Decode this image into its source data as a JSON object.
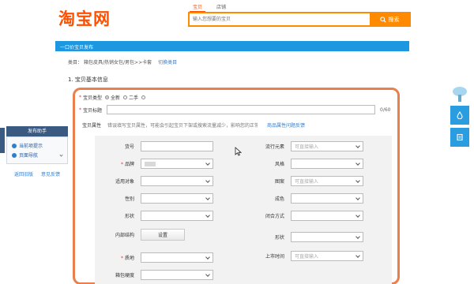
{
  "logo": "淘宝网",
  "search": {
    "tabs": [
      "宝贝",
      "店铺"
    ],
    "placeholder": "输入您想要的宝贝",
    "button": "搜索"
  },
  "banner": "一口价宝贝发布",
  "breadcrumb": {
    "prefix": "类目：",
    "path": "箱包皮具/热销女包/男包>>卡套",
    "switch": "切换类目"
  },
  "section_title": "1. 宝贝基本信息",
  "form": {
    "type_label": "宝贝类型",
    "type_options": [
      "全新",
      "二手"
    ],
    "title_label": "宝贝标题",
    "counter": "0/60",
    "attr_label": "宝贝属性",
    "attr_note": "错误填写宝贝属性，可能会引起宝贝下架或搜索流量减少，影响您的正常销售，请认真准确填写！",
    "attr_link": "商品属性问题反馈"
  },
  "attributes": {
    "left": [
      {
        "label": "货号",
        "kind": "text",
        "required": false
      },
      {
        "label": "品牌",
        "kind": "select",
        "required": true,
        "blot": true
      },
      {
        "label": "适用对象",
        "kind": "select",
        "required": false
      },
      {
        "label": "性别",
        "kind": "select",
        "required": false
      },
      {
        "label": "形状",
        "kind": "select",
        "required": false
      },
      {
        "label": "内部结构",
        "kind": "button",
        "button": "设置",
        "required": false
      },
      {
        "label": "质地",
        "kind": "select",
        "required": true
      },
      {
        "label": "箱包硬度",
        "kind": "select",
        "required": false
      }
    ],
    "right": [
      {
        "label": "流行元素",
        "placeholder": "可直接输入"
      },
      {
        "label": "风格",
        "placeholder": ""
      },
      {
        "label": "图案",
        "placeholder": "可直接输入"
      },
      {
        "label": "成色",
        "placeholder": ""
      },
      {
        "label": "闭合方式",
        "placeholder": ""
      },
      {
        "label": "形状",
        "placeholder": ""
      },
      {
        "label": "上市时间",
        "placeholder": "可直接输入"
      }
    ]
  },
  "helper": {
    "title": "发布助手",
    "items": [
      "当前项提示",
      "页面导航"
    ],
    "links": [
      "返回旧版",
      "意见反馈"
    ]
  }
}
